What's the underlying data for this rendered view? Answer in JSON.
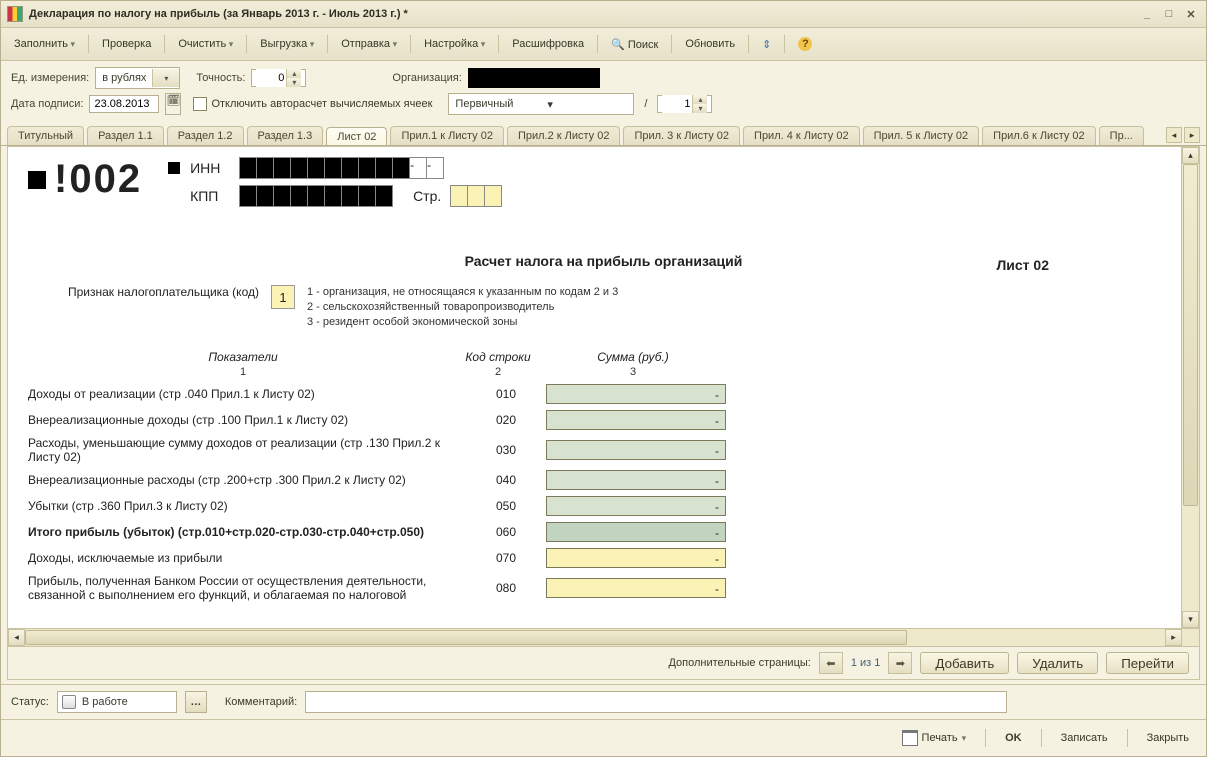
{
  "title": "Декларация по налогу на прибыль (за Январь 2013 г. - Июль 2013 г.) *",
  "toolbar": {
    "fill": "Заполнить",
    "check": "Проверка",
    "clear": "Очистить",
    "export": "Выгрузка",
    "send": "Отправка",
    "settings": "Настройка",
    "detail": "Расшифровка",
    "search": "Поиск",
    "refresh": "Обновить"
  },
  "params": {
    "unit_label": "Ед. измерения:",
    "unit_value": "в рублях",
    "precision_label": "Точность:",
    "precision_value": "0",
    "org_label": "Организация:",
    "date_label": "Дата подписи:",
    "date_value": "23.08.2013",
    "autocalc_label": "Отключить авторасчет вычисляемых ячеек",
    "doctype_value": "Первичный",
    "slash": "/",
    "page_value": "1"
  },
  "tabs": [
    "Титульный",
    "Раздел 1.1",
    "Раздел 1.2",
    "Раздел 1.3",
    "Лист 02",
    "Прил.1 к Листу 02",
    "Прил.2 к Листу 02",
    "Прил. 3 к Листу 02",
    "Прил. 4 к Листу 02",
    "Прил. 5 к Листу 02",
    "Прил.6 к Листу 02",
    "Пр..."
  ],
  "active_tab_index": 4,
  "doc": {
    "bigcode": "!002",
    "inn_label": "ИНН",
    "kpp_label": "КПП",
    "str_label": "Стр.",
    "sheet_title": "Лист 02",
    "calc_title": "Расчет налога на прибыль организаций",
    "sign_label": "Признак налогоплательщика (код)",
    "sign_value": "1",
    "legend1": "1 - организация, не относящаяся к указанным по кодам 2 и 3",
    "legend2": "2 - сельскохозяйственный товаропроизводитель",
    "legend3": "3 - резидент особой экономической зоны",
    "head_indicators": "Показатели",
    "head_linecode": "Код строки",
    "head_sum": "Сумма (руб.)",
    "sub1": "1",
    "sub2": "2",
    "sub3": "3",
    "rows": [
      {
        "label": "Доходы от реализации (стр .040 Прил.1 к Листу 02)",
        "code": "010",
        "val": "-",
        "cls": "g"
      },
      {
        "label": "Внереализационные доходы (стр .100 Прил.1 к Листу 02)",
        "code": "020",
        "val": "-",
        "cls": "g"
      },
      {
        "label": "Расходы, уменьшающие сумму доходов от реализации (стр .130 Прил.2 к Листу 02)",
        "code": "030",
        "val": "-",
        "cls": "g"
      },
      {
        "label": "Внереализационные расходы (стр .200+стр .300 Прил.2 к Листу 02)",
        "code": "040",
        "val": "-",
        "cls": "g"
      },
      {
        "label": "Убытки (стр .360 Прил.3 к Листу 02)",
        "code": "050",
        "val": "-",
        "cls": "g"
      },
      {
        "label": "Итого прибыль (убыток)  (стр.010+стр.020-стр.030-стр.040+стр.050)",
        "code": "060",
        "val": "-",
        "cls": "g2",
        "bold": true
      },
      {
        "label": "Доходы, исключаемые из прибыли",
        "code": "070",
        "val": "-",
        "cls": "y"
      },
      {
        "label": "Прибыль, полученная Банком России от осуществления деятельности, связанной с выполнением его функций, и облагаемая по налоговой",
        "code": "080",
        "val": "-",
        "cls": "y"
      }
    ]
  },
  "pager": {
    "label": "Дополнительные страницы:",
    "pos": "1 из 1",
    "add": "Добавить",
    "del": "Удалить",
    "go": "Перейти"
  },
  "status": {
    "label": "Статус:",
    "value": "В работе",
    "comment_label": "Комментарий:"
  },
  "footer": {
    "print": "Печать",
    "ok": "OK",
    "save": "Записать",
    "close": "Закрыть"
  }
}
